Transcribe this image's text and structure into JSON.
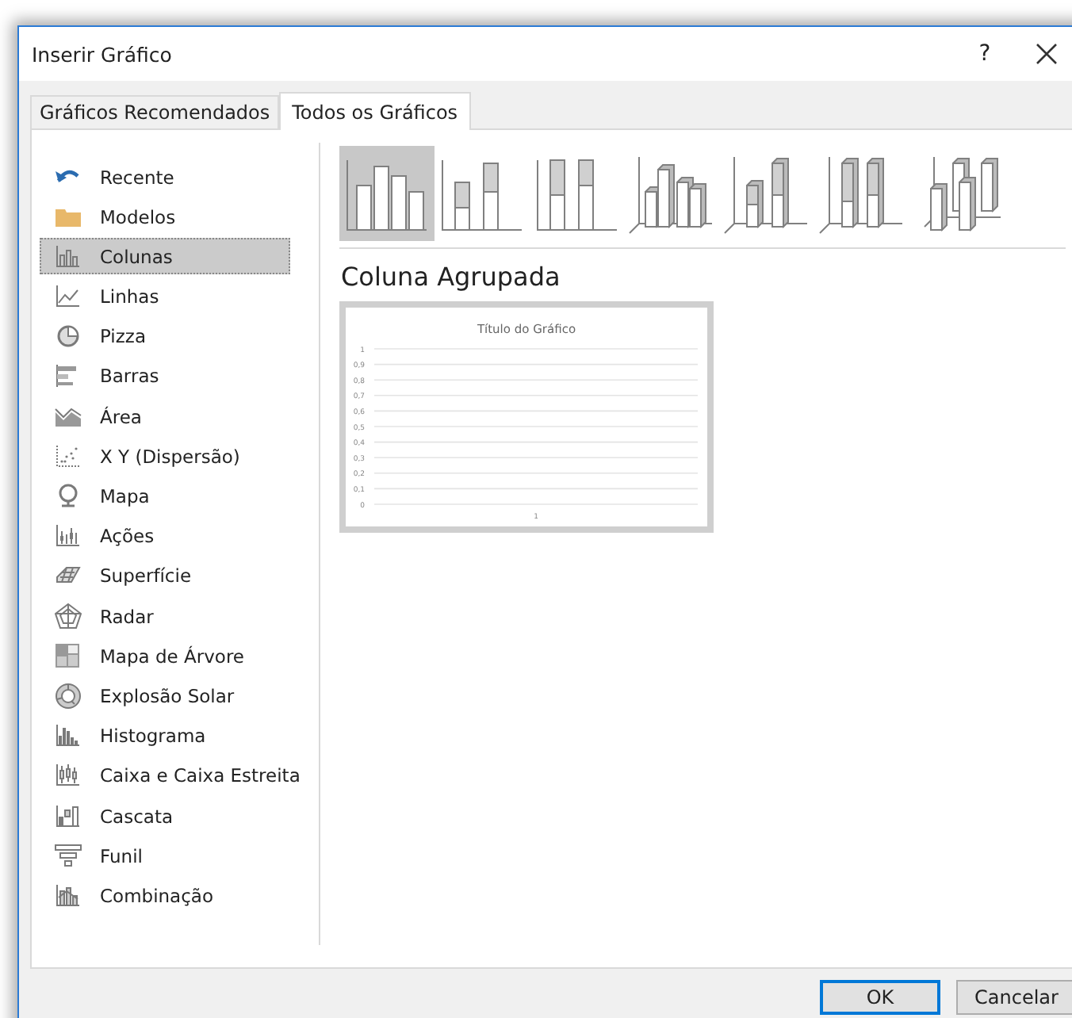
{
  "window": {
    "title": "Inserir Gráfico",
    "help": "?"
  },
  "tabs": [
    {
      "label": "Gráficos Recomendados",
      "selected": false
    },
    {
      "label": "Todos os Gráficos",
      "selected": true
    }
  ],
  "sidebar": {
    "items": [
      {
        "label": "Recente",
        "selected": false
      },
      {
        "label": "Modelos",
        "selected": false
      },
      {
        "label": "Colunas",
        "selected": true
      },
      {
        "label": "Linhas",
        "selected": false
      },
      {
        "label": "Pizza",
        "selected": false
      },
      {
        "label": "Barras",
        "selected": false
      },
      {
        "label": "Área",
        "selected": false
      },
      {
        "label": "X Y (Dispersão)",
        "selected": false
      },
      {
        "label": "Mapa",
        "selected": false
      },
      {
        "label": "Ações",
        "selected": false
      },
      {
        "label": "Superfície",
        "selected": false
      },
      {
        "label": "Radar",
        "selected": false
      },
      {
        "label": "Mapa de Árvore",
        "selected": false
      },
      {
        "label": "Explosão Solar",
        "selected": false
      },
      {
        "label": "Histograma",
        "selected": false
      },
      {
        "label": "Caixa e Caixa Estreita",
        "selected": false
      },
      {
        "label": "Cascata",
        "selected": false
      },
      {
        "label": "Funil",
        "selected": false
      },
      {
        "label": "Combinação",
        "selected": false
      }
    ]
  },
  "subtypes": [
    {
      "selected": true
    },
    {
      "selected": false
    },
    {
      "selected": false
    },
    {
      "selected": false
    },
    {
      "selected": false
    },
    {
      "selected": false
    },
    {
      "selected": false
    }
  ],
  "subtype_title": "Coluna Agrupada",
  "preview": {
    "chart_data": {
      "type": "bar",
      "title": "Título do Gráfico",
      "categories": [
        "1"
      ],
      "values": [
        null
      ],
      "ylim": [
        0,
        1
      ],
      "grid": true,
      "yticks": [
        {
          "value": 0,
          "label": "0"
        },
        {
          "value": 0.1,
          "label": "0,1"
        },
        {
          "value": 0.2,
          "label": "0,2"
        },
        {
          "value": 0.3,
          "label": "0,3"
        },
        {
          "value": 0.4,
          "label": "0,4"
        },
        {
          "value": 0.5,
          "label": "0,5"
        },
        {
          "value": 0.6,
          "label": "0,6"
        },
        {
          "value": 0.7,
          "label": "0,7"
        },
        {
          "value": 0.8,
          "label": "0,8"
        },
        {
          "value": 0.9,
          "label": "0,9"
        },
        {
          "value": 1,
          "label": "1"
        }
      ]
    }
  },
  "buttons": [
    {
      "label": "OK",
      "kind": "default"
    },
    {
      "label": "Cancelar",
      "kind": "normal"
    }
  ]
}
